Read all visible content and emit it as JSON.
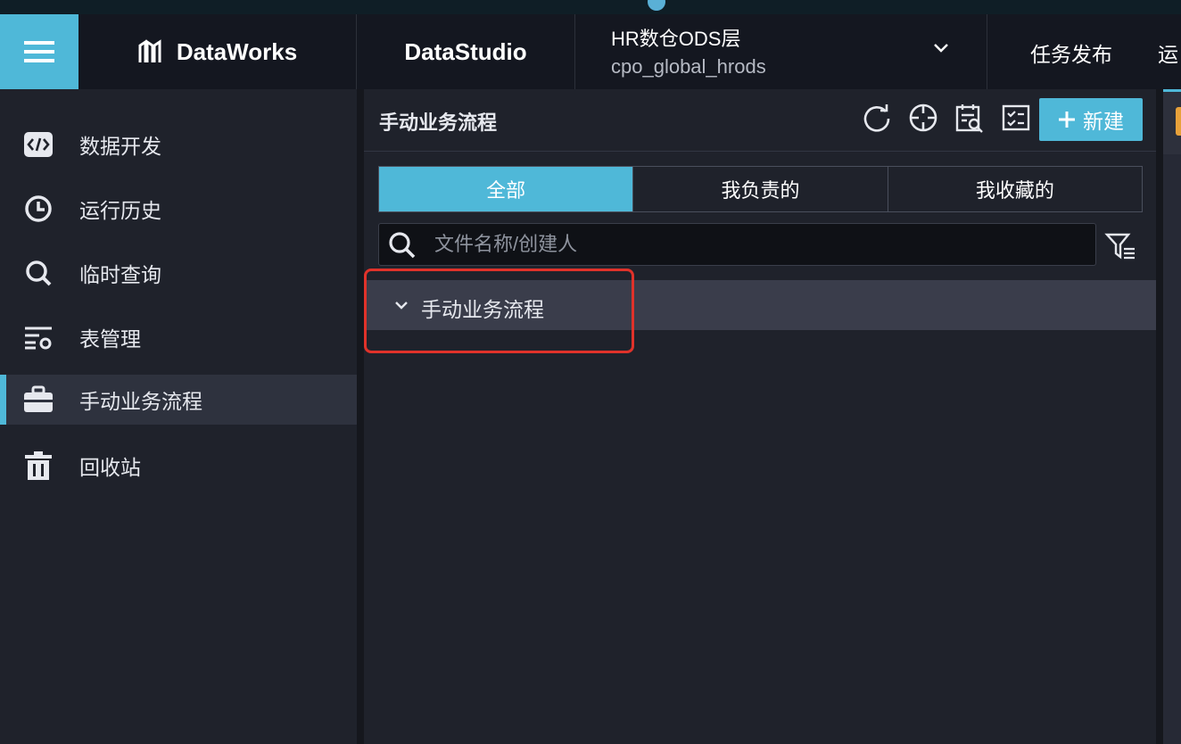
{
  "topbar": {
    "brand": "DataWorks",
    "module": "DataStudio",
    "project_name": "HR数仓ODS层",
    "project_namespace": "cpo_global_hrods",
    "publish": "任务发布",
    "ops": "运"
  },
  "sidebar": {
    "items": [
      {
        "label": "数据开发",
        "icon": "code-icon"
      },
      {
        "label": "运行历史",
        "icon": "clock-icon"
      },
      {
        "label": "临时查询",
        "icon": "search-icon"
      },
      {
        "label": "表管理",
        "icon": "table-manage-icon"
      },
      {
        "label": "手动业务流程",
        "icon": "briefcase-icon",
        "active": true
      },
      {
        "label": "回收站",
        "icon": "trash-icon"
      }
    ]
  },
  "panel": {
    "title": "手动业务流程",
    "new_button": "新建",
    "tabs": [
      "全部",
      "我负责的",
      "我收藏的"
    ],
    "active_tab": "全部",
    "search_placeholder": "文件名称/创建人",
    "tree": [
      {
        "label": "手动业务流程",
        "expanded": true
      }
    ]
  },
  "colors": {
    "accent": "#4fb8d8",
    "highlight": "#e0322a"
  }
}
